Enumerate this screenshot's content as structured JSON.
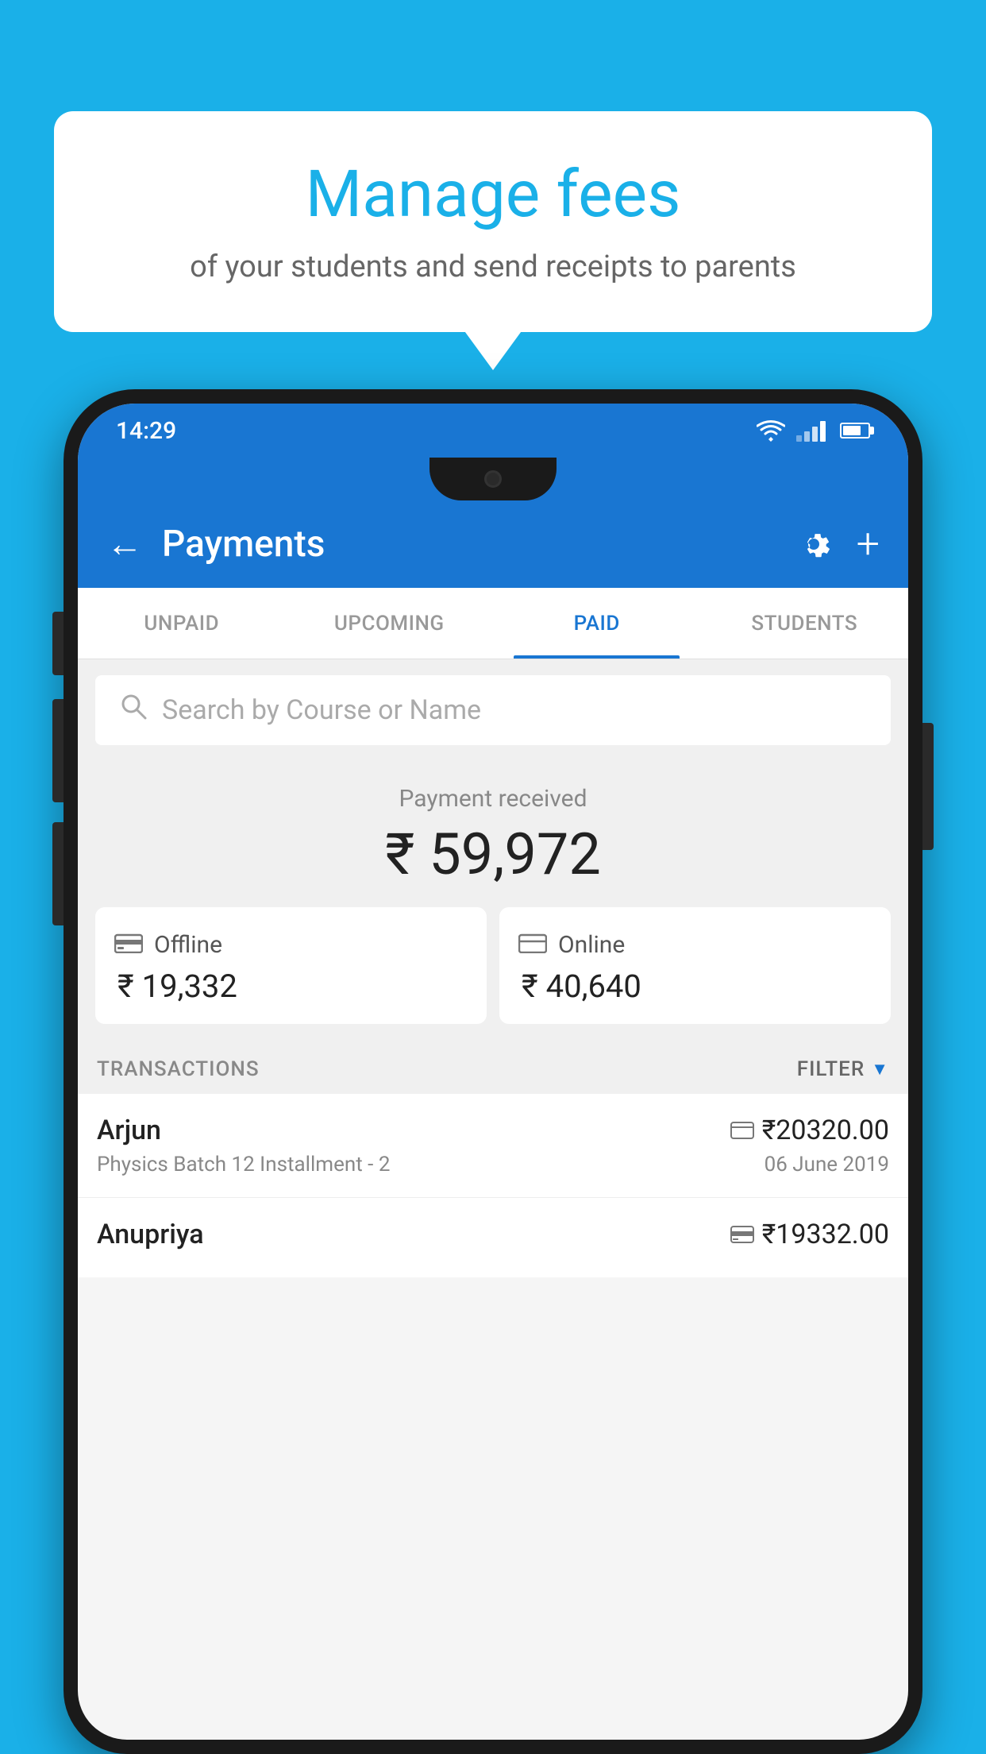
{
  "background_color": "#1AB0E8",
  "bubble": {
    "title": "Manage fees",
    "subtitle": "of your students and send receipts to parents"
  },
  "status_bar": {
    "time": "14:29"
  },
  "app_bar": {
    "title": "Payments",
    "back_label": "←",
    "plus_label": "+"
  },
  "tabs": [
    {
      "id": "unpaid",
      "label": "UNPAID",
      "active": false
    },
    {
      "id": "upcoming",
      "label": "UPCOMING",
      "active": false
    },
    {
      "id": "paid",
      "label": "PAID",
      "active": true
    },
    {
      "id": "students",
      "label": "STUDENTS",
      "active": false
    }
  ],
  "search": {
    "placeholder": "Search by Course or Name"
  },
  "payment_summary": {
    "label": "Payment received",
    "total": "₹ 59,972",
    "offline_label": "Offline",
    "offline_amount": "₹ 19,332",
    "online_label": "Online",
    "online_amount": "₹ 40,640"
  },
  "transactions": {
    "header": "TRANSACTIONS",
    "filter_label": "FILTER",
    "items": [
      {
        "name": "Arjun",
        "course": "Physics Batch 12 Installment - 2",
        "amount": "₹20320.00",
        "date": "06 June 2019",
        "payment_type": "online"
      },
      {
        "name": "Anupriya",
        "course": "",
        "amount": "₹19332.00",
        "date": "",
        "payment_type": "offline"
      }
    ]
  }
}
